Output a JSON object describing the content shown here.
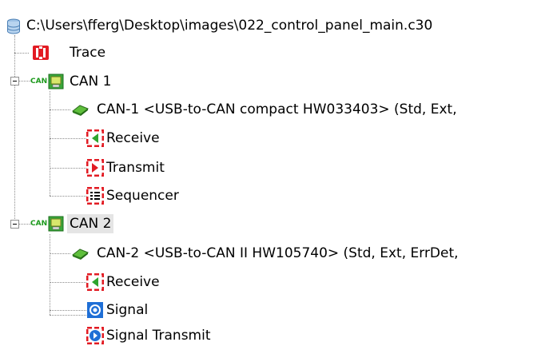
{
  "tree": {
    "root": {
      "path": "C:\\Users\\fferg\\Desktop\\images\\022_control_panel_main.c30",
      "icon": "database-icon"
    },
    "trace": {
      "label": "Trace",
      "icon": "trace-icon"
    },
    "can1": {
      "label": "CAN 1",
      "badge": "CAN",
      "device": "CAN-1  <USB-to-CAN compact HW033403>  (Std, Ext,",
      "children": [
        "Receive",
        "Transmit",
        "Sequencer"
      ]
    },
    "can2": {
      "label": "CAN 2",
      "badge": "CAN",
      "device": "CAN-2  <USB-to-CAN II HW105740>  (Std, Ext, ErrDet,",
      "children": [
        "Receive",
        "Signal",
        "Signal Transmit"
      ]
    }
  },
  "colors": {
    "icon_red": "#e21b23",
    "icon_green": "#2ea52e",
    "icon_blue": "#1f6fd6",
    "selection": "#e5e5e5"
  }
}
